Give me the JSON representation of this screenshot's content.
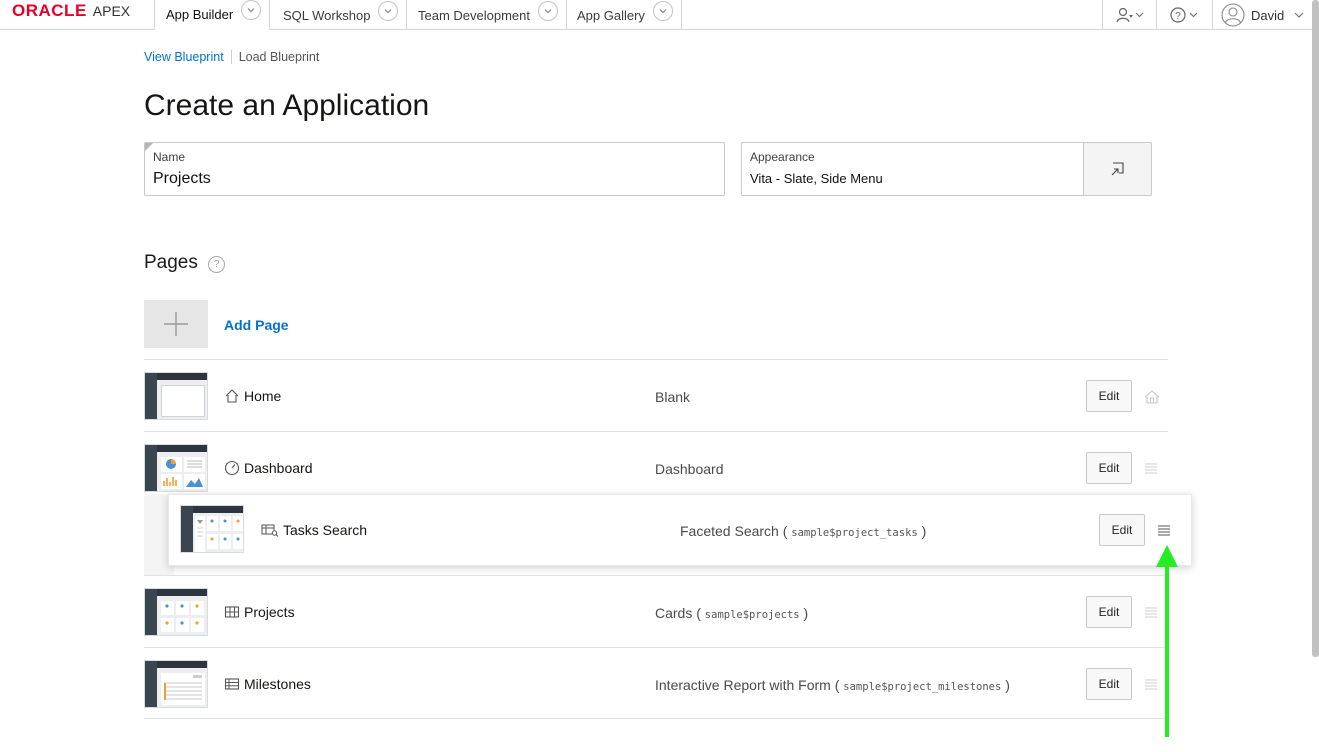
{
  "brand": {
    "oracle": "ORACLE",
    "apex": "APEX"
  },
  "nav": {
    "tabs": [
      {
        "label": "App Builder"
      },
      {
        "label": "SQL Workshop"
      },
      {
        "label": "Team Development"
      },
      {
        "label": "App Gallery"
      }
    ],
    "user": "David"
  },
  "blueprint": {
    "view": "View Blueprint",
    "load": "Load Blueprint"
  },
  "title": "Create an Application",
  "name_field": {
    "label": "Name",
    "value": "Projects"
  },
  "appearance_field": {
    "label": "Appearance",
    "value": "Vita - Slate, Side Menu"
  },
  "pages": {
    "title": "Pages",
    "help": "?",
    "add_label": "Add Page",
    "edit_label": "Edit",
    "items": [
      {
        "name": "Home",
        "type": "Blank",
        "source": "",
        "icon": "home-icon"
      },
      {
        "name": "Dashboard",
        "type": "Dashboard",
        "source": "",
        "icon": "dashboard-icon"
      },
      {
        "name": "Tasks Search",
        "type": "Faceted Search (",
        "source": "sample$project_tasks",
        "close": ")",
        "icon": "faceted-search-icon"
      },
      {
        "name": "Projects",
        "type": "Cards (",
        "source": "sample$projects",
        "close": ")",
        "icon": "cards-icon"
      },
      {
        "name": "Milestones",
        "type": "Interactive Report with Form (",
        "source": "sample$project_milestones",
        "close": ")",
        "icon": "report-icon"
      }
    ]
  },
  "colors": {
    "accent": "#0572ce",
    "brand_red": "#e4002b",
    "arrow": "#22ee22"
  }
}
